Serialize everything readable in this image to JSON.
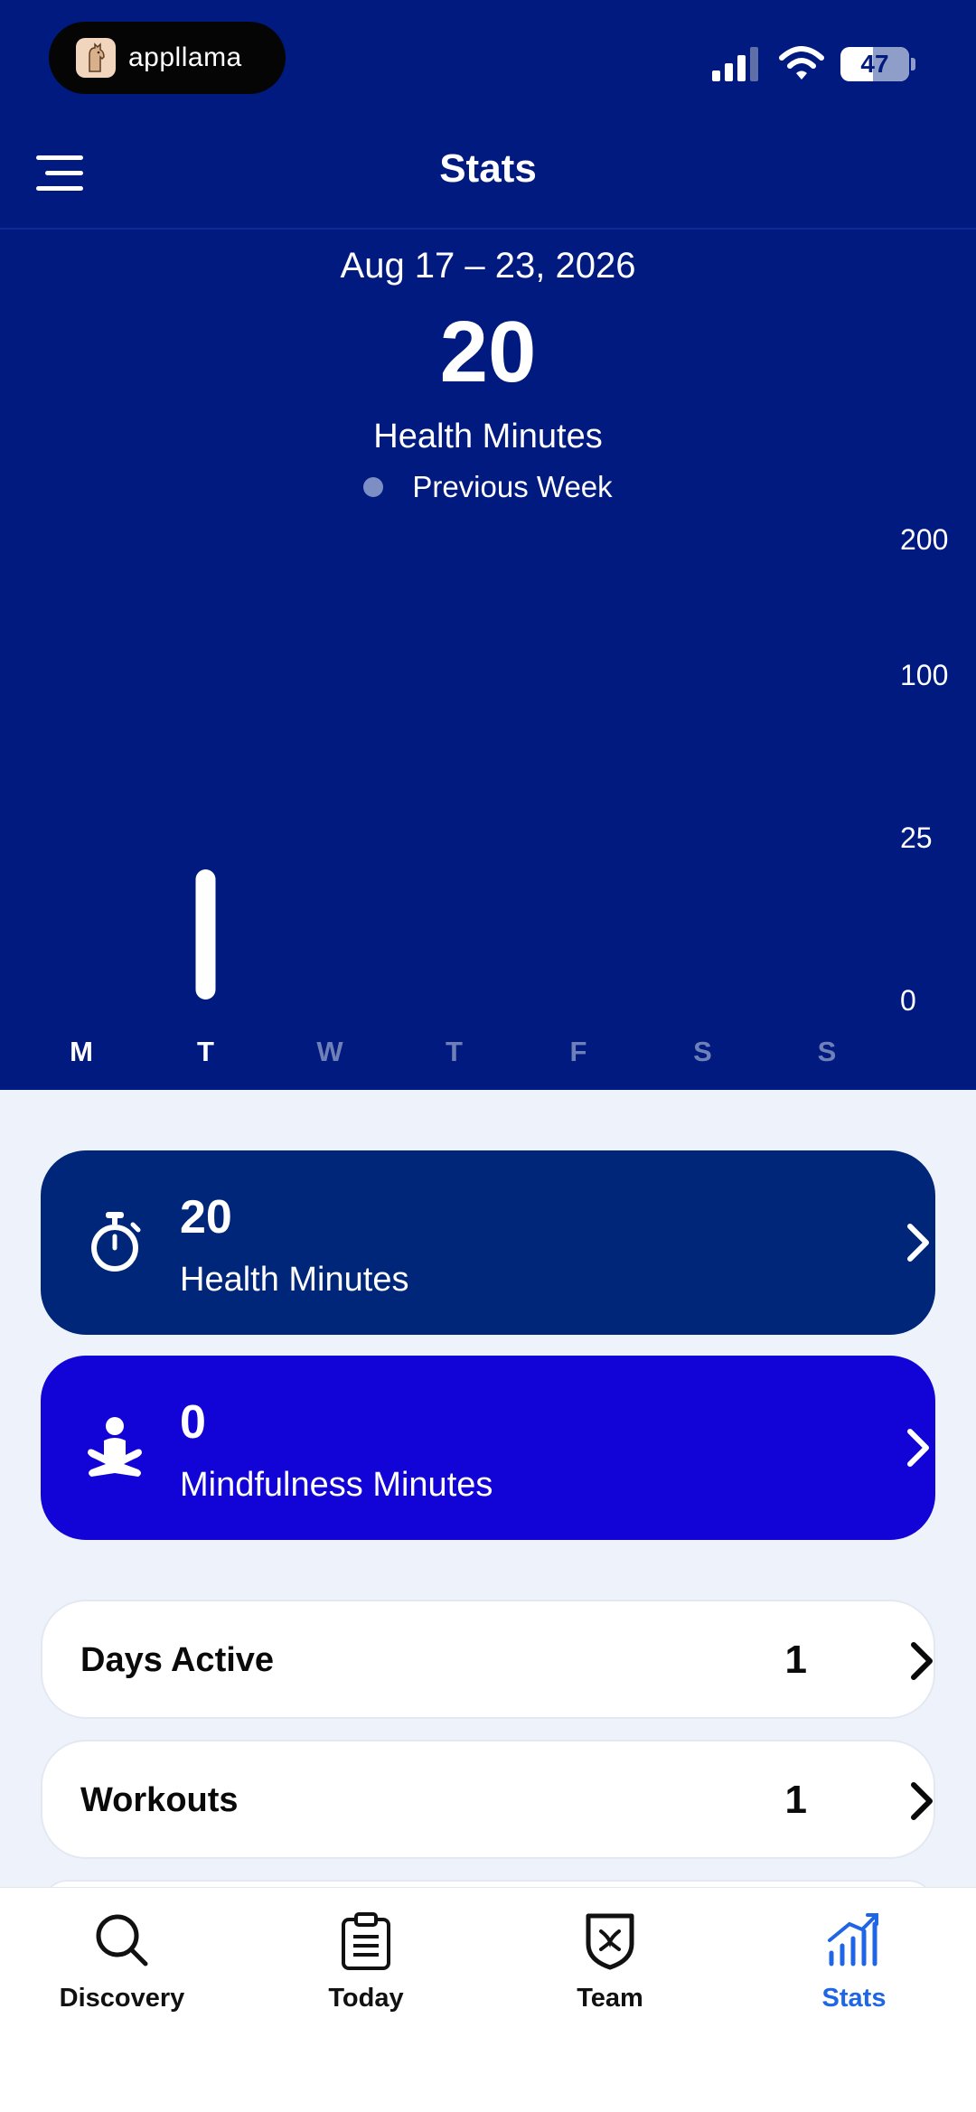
{
  "status_bar": {
    "app_badge": "appllama",
    "battery": "47"
  },
  "header": {
    "title": "Stats"
  },
  "summary": {
    "date_range": "Aug 17 – 23, 2026",
    "value": "20",
    "metric": "Health Minutes",
    "legend_label": "Previous Week"
  },
  "chart_data": {
    "type": "bar",
    "categories": [
      "M",
      "T",
      "W",
      "T",
      "F",
      "S",
      "S"
    ],
    "values": [
      0,
      20,
      0,
      0,
      0,
      0,
      0
    ],
    "y_ticks": [
      "200",
      "100",
      "25",
      "0"
    ],
    "y_tick_values": [
      200,
      100,
      25,
      0
    ],
    "active_days": 2,
    "colors": {
      "bar": "#ffffff",
      "active_day": "#ffffff",
      "inactive_day": "#6f80b8",
      "legend_dot": "#7d8ec4"
    }
  },
  "cards": {
    "health": {
      "value": "20",
      "label": "Health Minutes",
      "icon": "stopwatch-icon",
      "color": "#00267a"
    },
    "mindfulness": {
      "value": "0",
      "label": "Mindfulness Minutes",
      "icon": "meditation-icon",
      "color": "#1203d6"
    },
    "days_active": {
      "label": "Days Active",
      "value": "1"
    },
    "workouts": {
      "label": "Workouts",
      "value": "1"
    }
  },
  "tabbar": {
    "items": [
      {
        "label": "Discovery",
        "icon": "search-icon"
      },
      {
        "label": "Today",
        "icon": "clipboard-icon"
      },
      {
        "label": "Team",
        "icon": "shield-icon"
      },
      {
        "label": "Stats",
        "icon": "bar-chart-icon",
        "active": true
      }
    ],
    "active_color": "#1f66e6"
  }
}
